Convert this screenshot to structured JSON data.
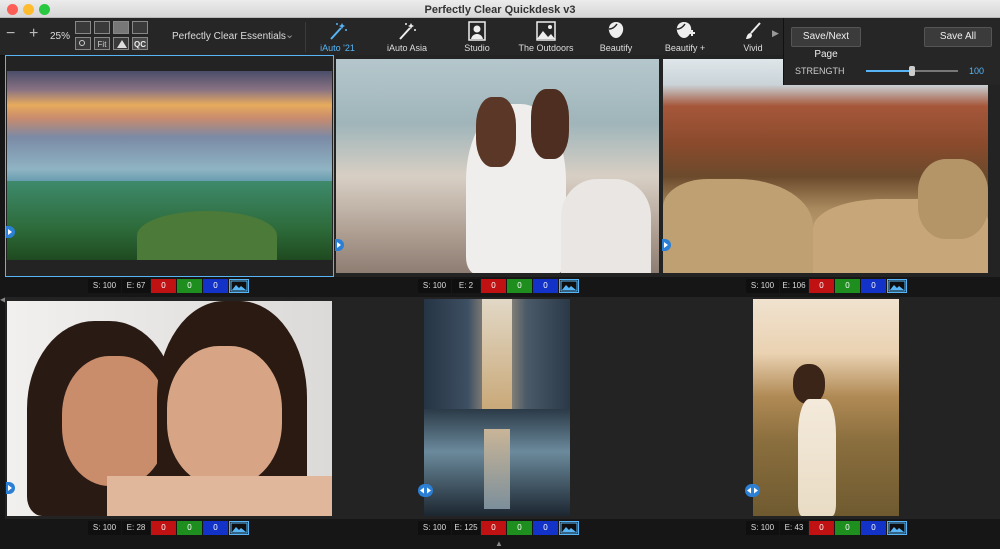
{
  "window": {
    "title": "Perfectly Clear Quickdesk v3"
  },
  "colors": {
    "accent": "#57b5f6",
    "red_badge": "#c01212",
    "green_badge": "#1e8e1e",
    "blue_badge": "#1232c8",
    "traffic_close": "#fd5f57",
    "traffic_min": "#febc2e",
    "traffic_max": "#28c840"
  },
  "toolbar": {
    "zoom_out_icon": "minus-icon",
    "zoom_in_icon": "plus-icon",
    "zoom_value": "25%",
    "layout": {
      "fit_label": "Fit",
      "qc_label": "QC"
    },
    "preset_name": "Perfectly Clear Essentials",
    "presets": [
      {
        "label": "iAuto '21",
        "icon": "magic-wand-icon",
        "active": true
      },
      {
        "label": "iAuto Asia",
        "icon": "magic-wand-icon",
        "active": false
      },
      {
        "label": "Studio",
        "icon": "portrait-icon",
        "active": false
      },
      {
        "label": "The Outdoors",
        "icon": "landscape-icon",
        "active": false
      },
      {
        "label": "Beautify",
        "icon": "face-icon",
        "active": false
      },
      {
        "label": "Beautify +",
        "icon": "face-plus-icon",
        "active": false
      },
      {
        "label": "Vivid",
        "icon": "brush-icon",
        "active": false
      }
    ]
  },
  "panel": {
    "save_next": "Save/Next Page",
    "save_all": "Save All",
    "strength_label": "STRENGTH",
    "strength_value": "100",
    "strength_level": 0.5
  },
  "images": [
    {
      "scene": "landscape-sunset",
      "s": "S: 100",
      "e": "E: 67",
      "r": "0",
      "g": "0",
      "b": "0"
    },
    {
      "scene": "dog-portrait",
      "s": "S: 100",
      "e": "E: 2",
      "r": "0",
      "g": "0",
      "b": "0"
    },
    {
      "scene": "red-canyon",
      "s": "S: 100",
      "e": "E: 106",
      "r": "0",
      "g": "0",
      "b": "0"
    },
    {
      "scene": "two-women-smiling",
      "s": "S: 100",
      "e": "E: 28",
      "r": "0",
      "g": "0",
      "b": "0"
    },
    {
      "scene": "city-street-reflection",
      "s": "S: 100",
      "e": "E: 125",
      "r": "0",
      "g": "0",
      "b": "0"
    },
    {
      "scene": "woman-in-field",
      "s": "S: 100",
      "e": "E: 43",
      "r": "0",
      "g": "0",
      "b": "0"
    }
  ]
}
